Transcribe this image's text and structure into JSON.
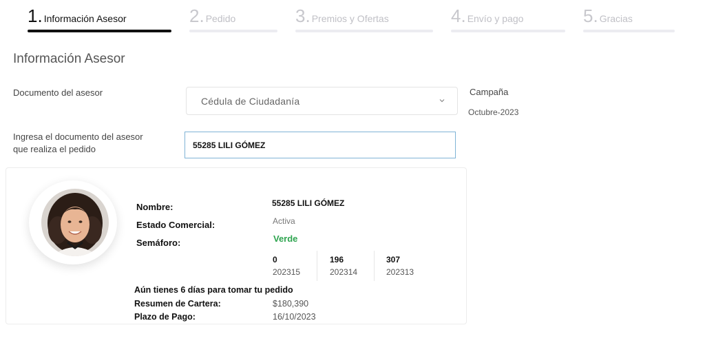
{
  "steps": [
    {
      "num": "1.",
      "label": "Información Asesor",
      "active": true
    },
    {
      "num": "2.",
      "label": "Pedido",
      "active": false
    },
    {
      "num": "3.",
      "label": "Premios y Ofertas",
      "active": false
    },
    {
      "num": "4.",
      "label": "Envío y pago",
      "active": false
    },
    {
      "num": "5.",
      "label": "Gracias",
      "active": false
    }
  ],
  "section_title": "Información Asesor",
  "document_field": {
    "label": "Documento del asesor",
    "value": "Cédula de Ciudadanía"
  },
  "campaign": {
    "label": "Campaña",
    "value": "Octubre-2023"
  },
  "advisor_doc_field": {
    "label_line1": "Ingresa el documento del asesor",
    "label_line2": "que realiza el pedido",
    "value": "55285 LILI GÓMEZ"
  },
  "card": {
    "name_label": "Nombre:",
    "name_value": "55285 LILI GÓMEZ",
    "status_label": "Estado Comercial:",
    "status_value": "Activa",
    "semaphore_label": "Semáforo:",
    "semaphore_value": "Verde",
    "stats": [
      {
        "value": "0",
        "campaign": "202315"
      },
      {
        "value": "196",
        "campaign": "202314"
      },
      {
        "value": "307",
        "campaign": "202313"
      }
    ],
    "notice": "Aún tienes 6 días para tomar tu pedido",
    "portfolio_label": "Resumen de Cartera:",
    "portfolio_value": "$180,390",
    "due_label": "Plazo de Pago:",
    "due_value": "16/10/2023"
  },
  "colors": {
    "active_step": "#111111",
    "inactive_step": "#c8c8cd",
    "green": "#2ea44f",
    "input_border": "#7fb3d5"
  }
}
